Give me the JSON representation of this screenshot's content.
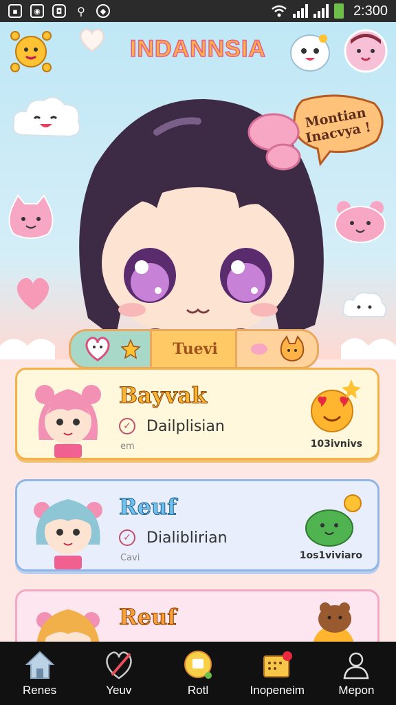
{
  "status_bar": {
    "time": "2:300",
    "icons": [
      "image-icon",
      "camera-icon",
      "app-icon",
      "usb-icon",
      "box-icon"
    ]
  },
  "header": {
    "title": "INDANNSIA",
    "speech_bubble": "Montian Inacvya !"
  },
  "tabs": {
    "active_label": "Tuevi",
    "left_icon": "heart-face-icon",
    "right_icon": "fox-icon"
  },
  "cards": [
    {
      "name": "Bayvak",
      "description": "Dailplisian",
      "sub": "em",
      "count": "103ivnivs",
      "accent": "#f5b048",
      "name_color": "#f7b733"
    },
    {
      "name": "Reuf",
      "description": "Dialiblirian",
      "sub": "Cavi",
      "count": "1os1viviaro",
      "accent": "#8fb6e6",
      "name_color": "#6fc1ee"
    },
    {
      "name": "Reuf",
      "description": "",
      "sub": "",
      "count": "",
      "accent": "#f4a8c4",
      "name_color": "#f6a13c"
    }
  ],
  "bottom_nav": [
    {
      "label": "Renes",
      "icon": "home-icon"
    },
    {
      "label": "Yeuv",
      "icon": "heart-pen-icon"
    },
    {
      "label": "Rotl",
      "icon": "chat-bubble-icon"
    },
    {
      "label": "Inopeneim",
      "icon": "notebook-icon"
    },
    {
      "label": "Mepon",
      "icon": "profile-icon"
    }
  ],
  "colors": {
    "status_bar": "#2b2b2b",
    "hero_sky": "#bfe7f5",
    "bottom_nav": "#111111",
    "battery": "#6cc04a"
  }
}
